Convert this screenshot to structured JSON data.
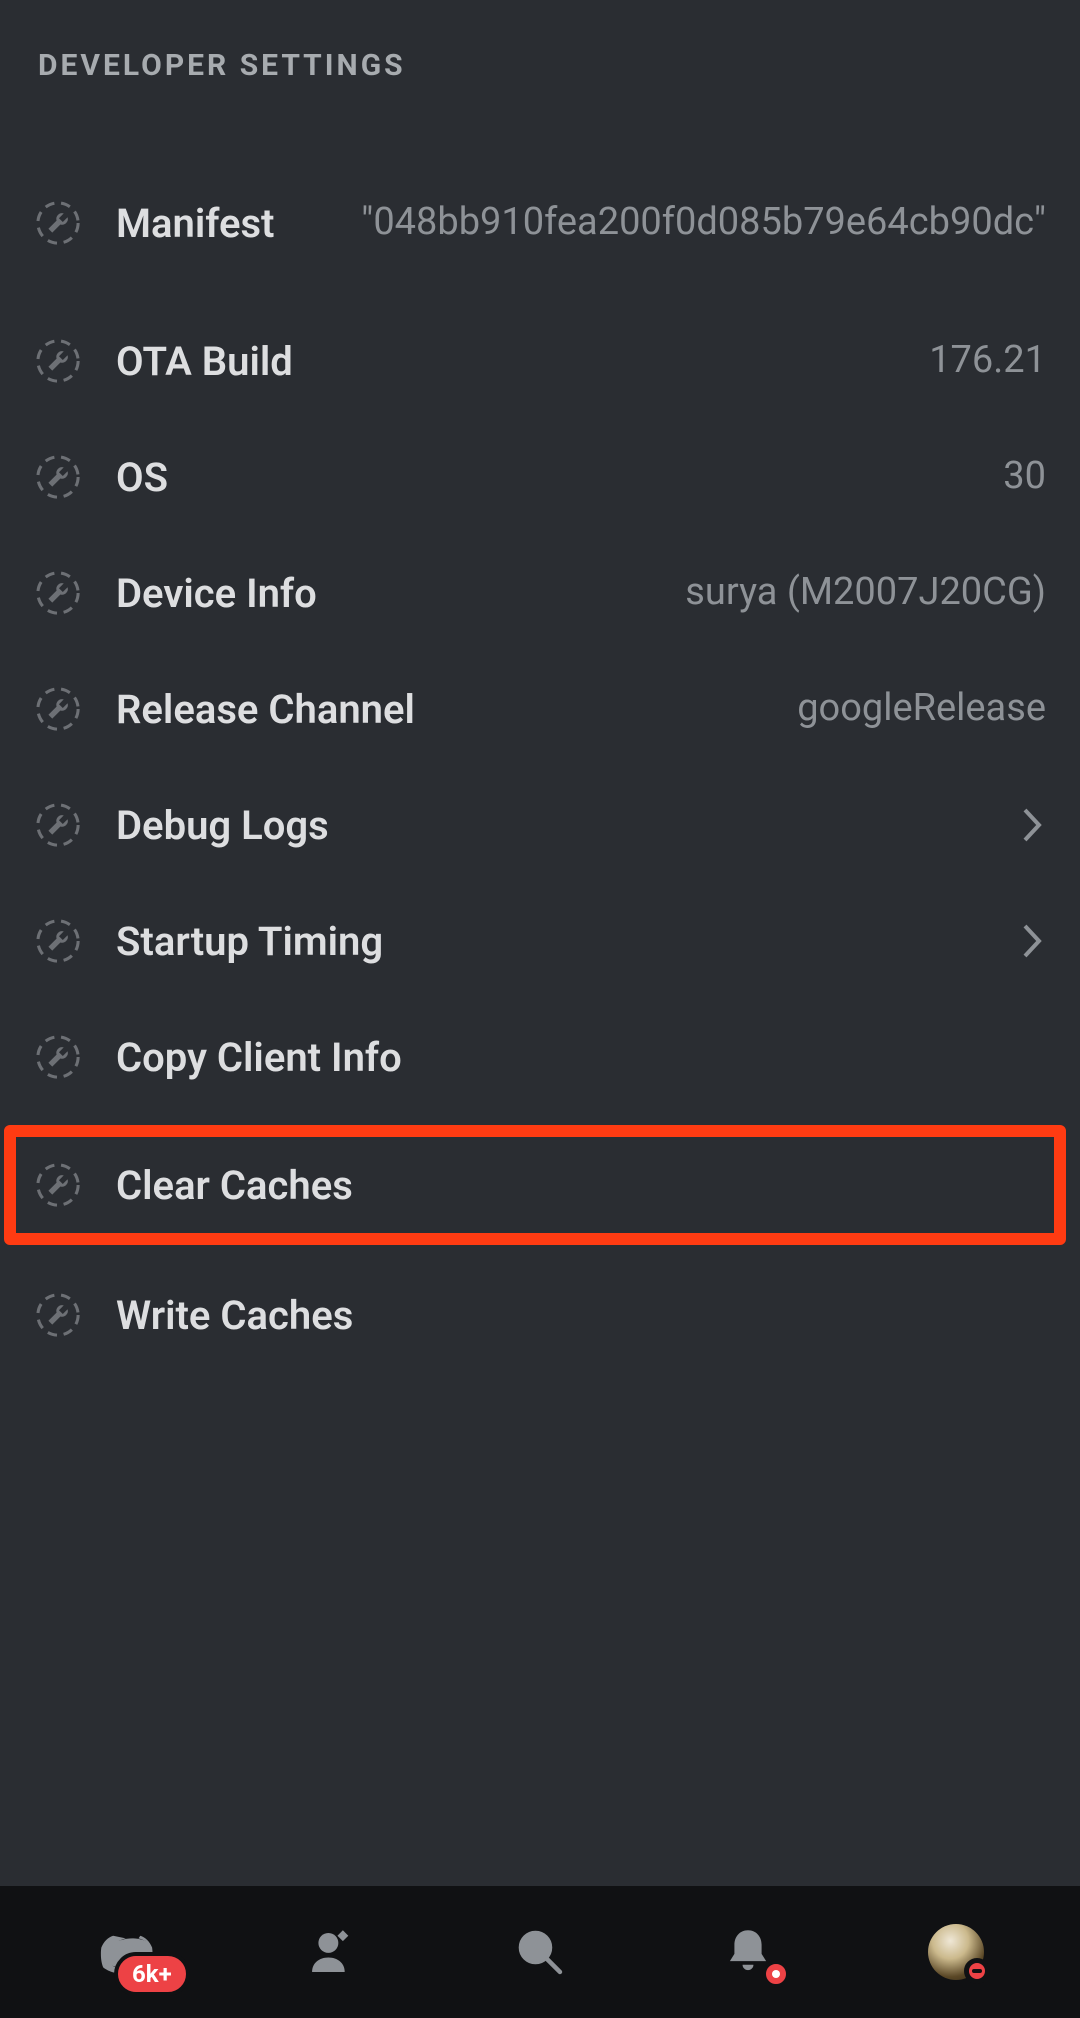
{
  "section_title": "DEVELOPER SETTINGS",
  "rows": {
    "manifest": {
      "label": "Manifest",
      "value": "\"048bb910fea200f0d085b79e64cb90dc\""
    },
    "ota_build": {
      "label": "OTA Build",
      "value": "176.21"
    },
    "os": {
      "label": "OS",
      "value": "30"
    },
    "device_info": {
      "label": "Device Info",
      "value": "surya (M2007J20CG)"
    },
    "release_channel": {
      "label": "Release Channel",
      "value": "googleRelease"
    },
    "debug_logs": {
      "label": "Debug Logs"
    },
    "startup_timing": {
      "label": "Startup Timing"
    },
    "copy_client": {
      "label": "Copy Client Info"
    },
    "clear_caches": {
      "label": "Clear Caches"
    },
    "write_caches": {
      "label": "Write Caches"
    }
  },
  "tabbar": {
    "home_badge": "6k+"
  }
}
